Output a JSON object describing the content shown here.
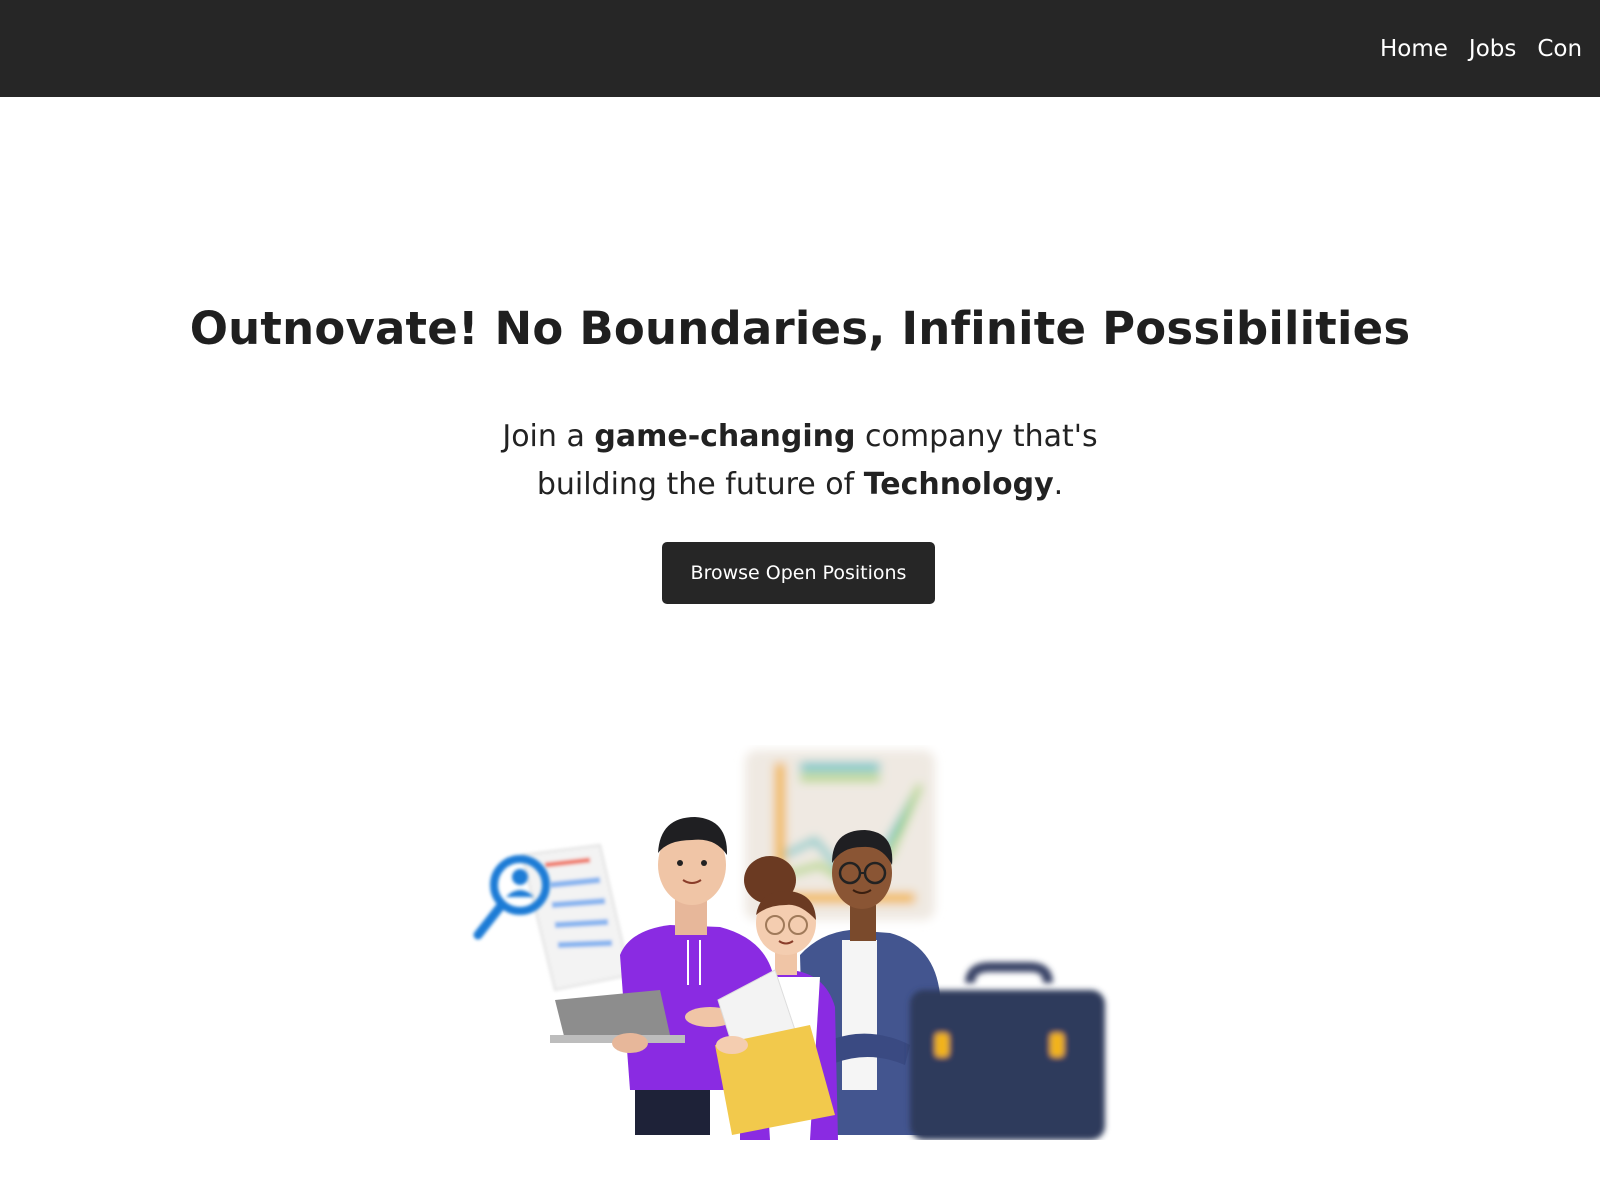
{
  "nav": {
    "links": [
      "Home",
      "Jobs",
      "Con"
    ]
  },
  "hero": {
    "title": "Outnovate! No Boundaries, Infinite Possibilities",
    "subtitle": {
      "part1": "Join a ",
      "bold1": "game-changing",
      "part2": " company that's",
      "part3": "building the future of ",
      "bold2": "Technology",
      "part4": "."
    },
    "cta_label": "Browse Open Positions"
  },
  "colors": {
    "navbar_bg": "#262626",
    "button_bg": "#262626",
    "text": "#222222",
    "accent_purple": "#8a2be2",
    "accent_blue": "#1e7bd6"
  },
  "illustration": {
    "icons": [
      "magnifier-user-icon",
      "chart-board",
      "laptop",
      "briefcase-icon",
      "folder"
    ]
  }
}
